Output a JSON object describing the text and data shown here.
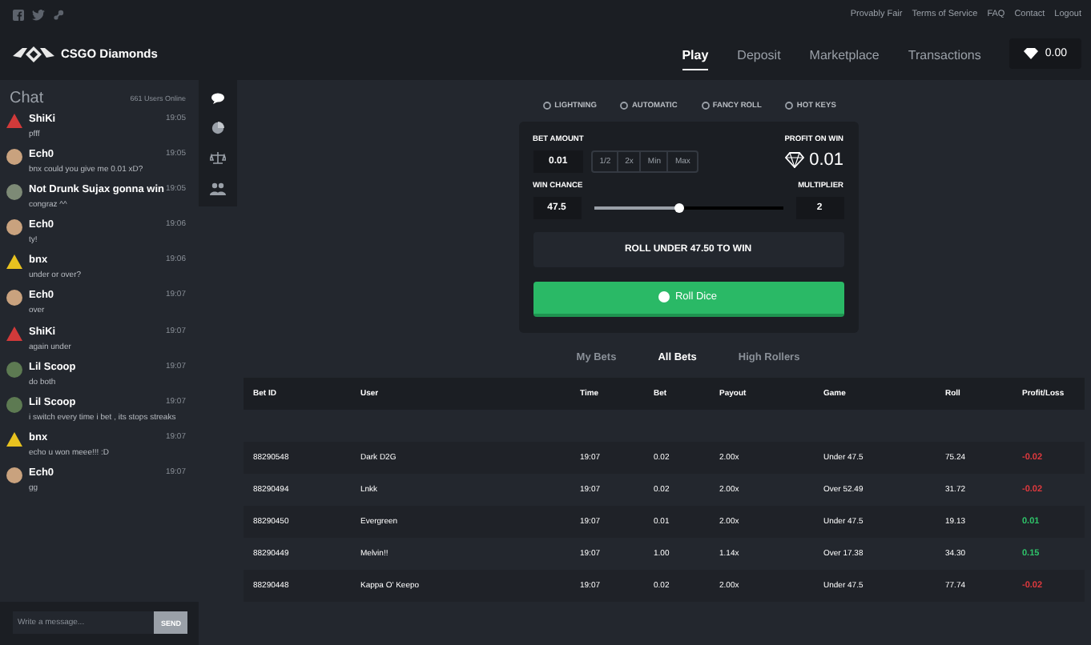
{
  "top_links": [
    "Provably Fair",
    "Terms of Service",
    "FAQ",
    "Contact",
    "Logout"
  ],
  "brand": "CSGO Diamonds",
  "nav": [
    {
      "label": "Play",
      "selected": true
    },
    {
      "label": "Deposit",
      "selected": false
    },
    {
      "label": "Marketplace",
      "selected": false
    },
    {
      "label": "Transactions",
      "selected": false
    }
  ],
  "balance": "0.00",
  "chat": {
    "title": "Chat",
    "online": "661 Users Online",
    "messages": [
      {
        "user": "ShiKi",
        "time": "19:05",
        "text": "pfff",
        "kind": "logo",
        "color": "#d23a3a"
      },
      {
        "user": "Ech0",
        "time": "19:05",
        "text": "bnx could you give me 0.01 xD?",
        "kind": "avatar",
        "color": "#c9a27e"
      },
      {
        "user": "Not Drunk Sujax gonna win",
        "time": "19:05",
        "text": "congraz ^^",
        "kind": "avatar",
        "color": "#7d8a76"
      },
      {
        "user": "Ech0",
        "time": "19:06",
        "text": "ty!",
        "kind": "avatar",
        "color": "#c9a27e"
      },
      {
        "user": "bnx",
        "time": "19:06",
        "text": "under or over?",
        "kind": "logo",
        "color": "#e8c21f"
      },
      {
        "user": "Ech0",
        "time": "19:07",
        "text": "over",
        "kind": "avatar",
        "color": "#c9a27e"
      },
      {
        "user": "ShiKi",
        "time": "19:07",
        "text": "again under",
        "kind": "logo",
        "color": "#d23a3a"
      },
      {
        "user": "Lil Scoop",
        "time": "19:07",
        "text": "do both",
        "kind": "avatar",
        "color": "#5d7a52"
      },
      {
        "user": "Lil Scoop",
        "time": "19:07",
        "text": "i switch every time i bet , its stops streaks",
        "kind": "avatar",
        "color": "#5d7a52"
      },
      {
        "user": "bnx",
        "time": "19:07",
        "text": "echo u won meee!!! :D",
        "kind": "logo",
        "color": "#e8c21f"
      },
      {
        "user": "Ech0",
        "time": "19:07",
        "text": "gg",
        "kind": "avatar",
        "color": "#c9a27e"
      }
    ],
    "input": {
      "placeholder": "Write a message..."
    },
    "send": "SEND"
  },
  "modes": [
    "LIGHTNING",
    "AUTOMATIC",
    "FANCY ROLL",
    "HOT KEYS"
  ],
  "dice": {
    "bet_label": "BET AMOUNT",
    "bet": "0.01",
    "quick": [
      "1/2",
      "2x",
      "Min",
      "Max"
    ],
    "profit_label": "PROFIT ON WIN",
    "profit": "0.01",
    "chance_label": "WIN CHANCE",
    "chance": "47.5",
    "level": 0.45,
    "multiplier_label": "MULTIPLIER",
    "multiplier": "2",
    "target": "ROLL UNDER 47.50 TO WIN",
    "roll": "Roll Dice"
  },
  "bet_tabs": [
    {
      "label": "My Bets",
      "selected": false
    },
    {
      "label": "All Bets",
      "selected": true
    },
    {
      "label": "High Rollers",
      "selected": false
    }
  ],
  "table": {
    "columns": [
      "Bet ID",
      "User",
      "Time",
      "Bet",
      "Payout",
      "Game",
      "Roll",
      "Profit/Loss"
    ],
    "rows": [
      {
        "cells": [
          "88290548",
          "Dark D2G",
          "19:07",
          "0.02",
          "2.00x",
          "Under 47.5",
          "75.24",
          "-0.02"
        ],
        "color": "#e0393e"
      },
      {
        "cells": [
          "88290494",
          "Lnkk",
          "19:07",
          "0.02",
          "2.00x",
          "Over 52.49",
          "31.72",
          "-0.02"
        ],
        "color": "#e0393e"
      },
      {
        "cells": [
          "88290450",
          "Evergreen",
          "19:07",
          "0.01",
          "2.00x",
          "Under 47.5",
          "19.13",
          "0.01"
        ],
        "color": "#2fc46a"
      },
      {
        "cells": [
          "88290449",
          "Melvin!!",
          "19:07",
          "1.00",
          "1.14x",
          "Over 17.38",
          "34.30",
          "0.15"
        ],
        "color": "#2fc46a"
      },
      {
        "cells": [
          "88290448",
          "Kappa O' Keepo",
          "19:07",
          "0.02",
          "2.00x",
          "Under 47.5",
          "77.74",
          "-0.02"
        ],
        "color": "#e0393e"
      }
    ]
  }
}
